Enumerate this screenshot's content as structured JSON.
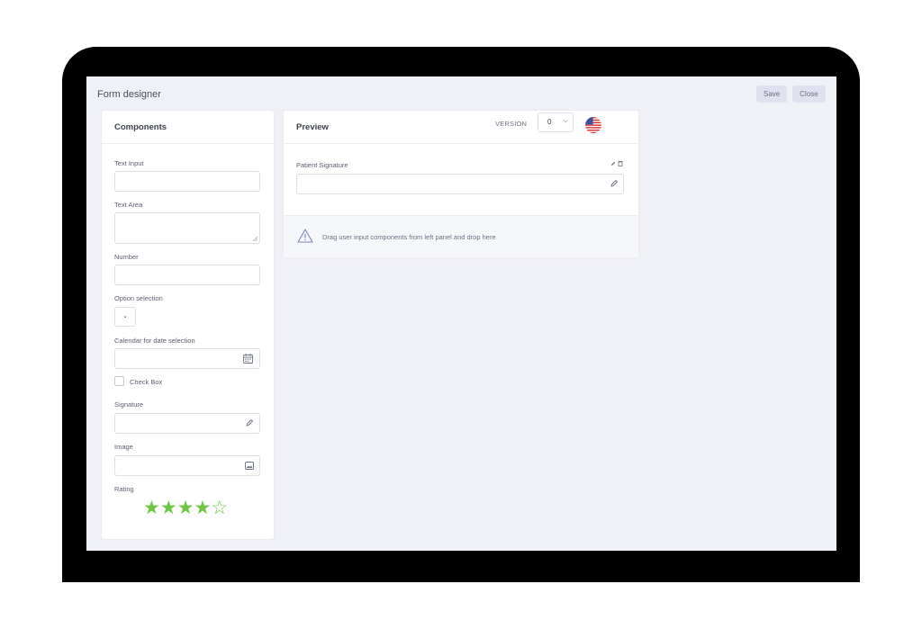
{
  "app": {
    "title": "Form designer"
  },
  "toolbar": {
    "save_label": "Save",
    "close_label": "Close"
  },
  "components": {
    "title": "Components",
    "text_input_label": "Text Input",
    "text_area_label": "Text Area",
    "number_label": "Number",
    "option_label": "Option selection",
    "calendar_label": "Calendar for date selection",
    "checkbox_label": "Check Box",
    "signature_label": "Signature",
    "image_label": "Image",
    "rating_label": "Rating",
    "rating": {
      "value": 4,
      "max": 5,
      "color": "#6cc644"
    }
  },
  "preview": {
    "title": "Preview",
    "version_label": "VERSION",
    "version_value": "0",
    "language_flag": "us-flag-icon",
    "field_label": "Patient Signature",
    "drop_hint": "Drag user input components from left panel and drop here"
  }
}
